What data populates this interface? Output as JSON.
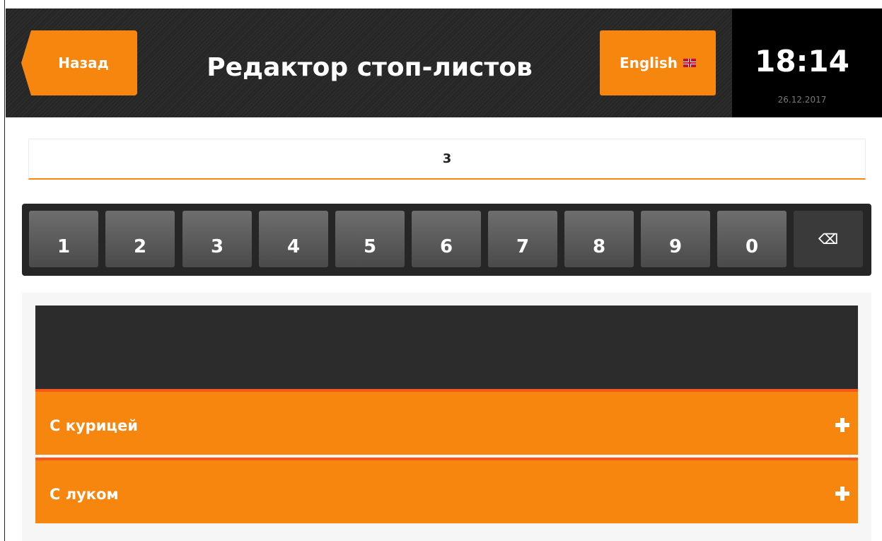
{
  "header": {
    "back_label": "Назад",
    "title": "Редактор стоп-листов",
    "language_label": "English",
    "time": "18:14",
    "date": "26.12.2017"
  },
  "search": {
    "value": "3"
  },
  "keypad": {
    "keys": [
      "1",
      "2",
      "3",
      "4",
      "5",
      "6",
      "7",
      "8",
      "9",
      "0"
    ],
    "backspace_glyph": "⌫"
  },
  "items": [
    {
      "label": "С курицей"
    },
    {
      "label": "С луком"
    }
  ],
  "colors": {
    "accent": "#f7860f",
    "accent_border": "#f8571a",
    "header_bg": "#262626"
  }
}
